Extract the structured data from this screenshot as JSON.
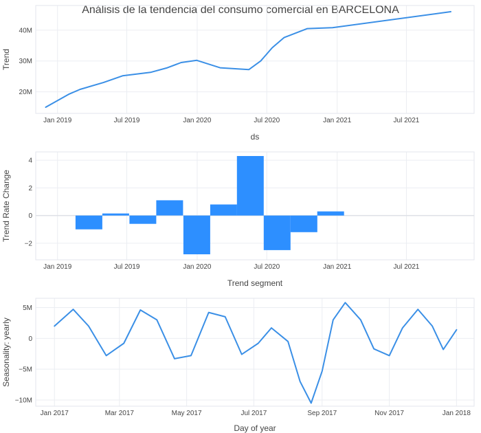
{
  "title": "Análisis de la tendencia del consumo comercial en BARCELONA",
  "colors": {
    "line": "#3a8fe6",
    "bar": "#2d8fff",
    "grid": "#ebedf2",
    "frame": "#e3e6ec",
    "text": "#444444"
  },
  "chart_data": [
    {
      "type": "line",
      "xlabel": "ds",
      "ylabel": "Trend",
      "x_ticks": [
        "Jan 2019",
        "Jul 2019",
        "Jan 2020",
        "Jul 2020",
        "Jan 2021",
        "Jul 2021"
      ],
      "y_ticks": [
        "20M",
        "30M",
        "40M"
      ],
      "xlim": [
        "2018-11-05",
        "2021-12-25"
      ],
      "ylim": [
        13000000,
        48000000
      ],
      "grid": true,
      "series": [
        {
          "x": [
            "2018-12-01",
            "2019-01-30",
            "2019-03-01",
            "2019-05-01",
            "2019-06-20",
            "2019-09-01",
            "2019-10-15",
            "2019-11-20",
            "2019-12-31",
            "2020-03-01",
            "2020-05-15",
            "2020-06-15",
            "2020-07-15",
            "2020-08-15",
            "2020-10-15",
            "2020-12-20",
            "2021-10-25"
          ],
          "y": [
            15000000,
            19200000,
            20800000,
            23000000,
            25200000,
            26300000,
            27800000,
            29500000,
            30200000,
            27800000,
            27200000,
            30000000,
            34300000,
            37600000,
            40500000,
            40800000,
            46000000
          ]
        }
      ]
    },
    {
      "type": "bar",
      "xlabel": "Trend segment",
      "ylabel": "Trend Rate Change",
      "x_ticks": [
        "Jan 2019",
        "Jul 2019",
        "Jan 2020",
        "Jul 2020",
        "Jan 2021",
        "Jul 2021"
      ],
      "y_ticks": [
        "4",
        "2",
        "0",
        "−2"
      ],
      "xlim": [
        "2018-11-05",
        "2021-12-25"
      ],
      "ylim": [
        -3.2,
        4.6
      ],
      "grid": true,
      "bars": [
        {
          "x": "2019-03-24",
          "value": -1.0
        },
        {
          "x": "2019-06-02",
          "value": 0.15
        },
        {
          "x": "2019-08-12",
          "value": -0.6
        },
        {
          "x": "2019-10-21",
          "value": 1.1
        },
        {
          "x": "2019-12-31",
          "value": -2.8
        },
        {
          "x": "2020-03-10",
          "value": 0.8
        },
        {
          "x": "2020-05-19",
          "value": 4.3
        },
        {
          "x": "2020-07-28",
          "value": -2.5
        },
        {
          "x": "2020-10-06",
          "value": -1.2
        },
        {
          "x": "2020-12-15",
          "value": 0.3
        }
      ]
    },
    {
      "type": "line",
      "xlabel": "Day of year",
      "ylabel": "Seasonality: yearly",
      "x_ticks": [
        "Jan 2017",
        "Mar 2017",
        "May 2017",
        "Jul 2017",
        "Sep 2017",
        "Nov 2017",
        "Jan 2018"
      ],
      "y_ticks": [
        "5M",
        "0",
        "−5M",
        "−10M"
      ],
      "xlim": [
        "2016-12-15",
        "2018-01-17"
      ],
      "ylim": [
        -11000000,
        6500000
      ],
      "grid": true,
      "series": [
        {
          "x": [
            "2017-01-01",
            "2017-01-18",
            "2017-02-01",
            "2017-02-17",
            "2017-03-05",
            "2017-03-20",
            "2017-04-04",
            "2017-04-20",
            "2017-05-05",
            "2017-05-21",
            "2017-06-05",
            "2017-06-20",
            "2017-07-05",
            "2017-07-17",
            "2017-08-01",
            "2017-08-12",
            "2017-08-22",
            "2017-09-01",
            "2017-09-11",
            "2017-09-22",
            "2017-10-06",
            "2017-10-18",
            "2017-11-01",
            "2017-11-13",
            "2017-11-27",
            "2017-12-10",
            "2017-12-20",
            "2018-01-01"
          ],
          "y": [
            2000000,
            4700000,
            2000000,
            -2800000,
            -800000,
            4600000,
            3000000,
            -3300000,
            -2800000,
            4200000,
            3500000,
            -2600000,
            -800000,
            1700000,
            -500000,
            -7000000,
            -10500000,
            -5300000,
            3000000,
            5800000,
            3000000,
            -1700000,
            -2800000,
            1700000,
            4700000,
            2000000,
            -1800000,
            1400000
          ]
        }
      ]
    }
  ]
}
